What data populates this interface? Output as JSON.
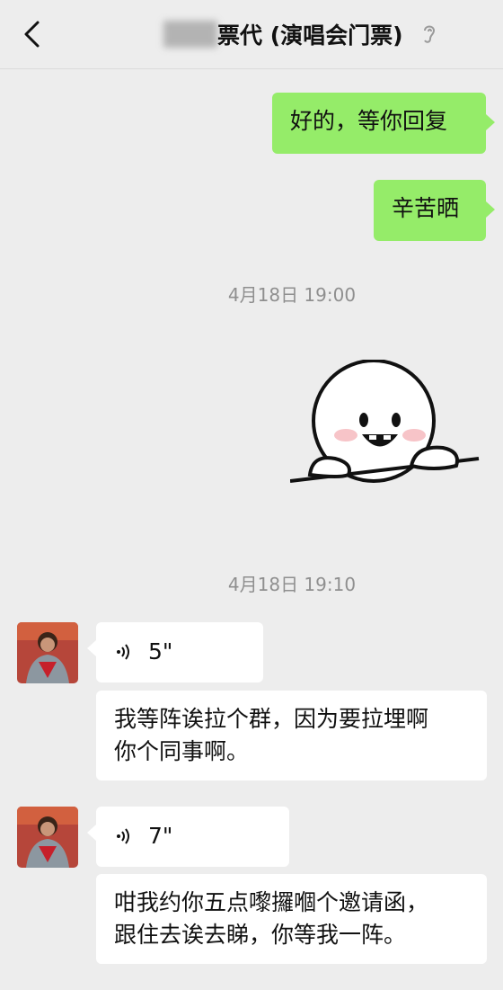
{
  "header": {
    "title": "票代 (演唱会门票)"
  },
  "messages": {
    "m1": "好的，等你回复",
    "m2": "辛苦晒",
    "ts1": "4月18日 19:00",
    "ts2": "4月18日 19:10",
    "voice1": "5\"",
    "text1_l1": "我等阵诶拉个群，因为要拉埋啊",
    "text1_l2": "你个同事啊。",
    "voice2": "7\"",
    "text2_l1": "咁我约你五点嚟攞嗰个邀请函，",
    "text2_l2": "跟住去诶去睇，你等我一阵。"
  },
  "colors": {
    "background": "#ededed",
    "my_bubble": "#95ec69",
    "their_bubble": "#ffffff",
    "timestamp": "#8f8f8f"
  },
  "icons": {
    "back": "chevron-left-icon",
    "ear": "ear-icon",
    "voice": "voice-wave-icon",
    "sticker": "smiley-peeking-sticker"
  }
}
